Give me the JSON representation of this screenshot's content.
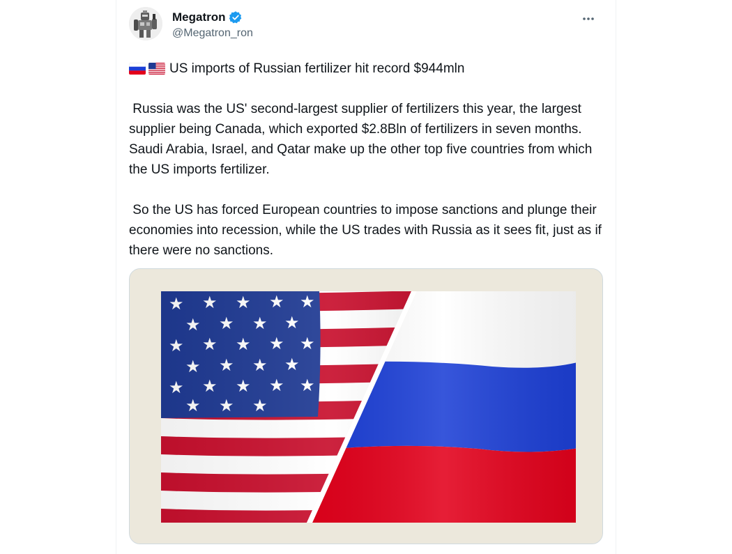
{
  "author": {
    "display_name": "Megatron",
    "handle": "@Megatron_ron",
    "verified": true,
    "avatar_icon": "robot-avatar-icon",
    "verified_icon": "verified-badge-icon"
  },
  "menu": {
    "more_icon": "more-horizontal-icon"
  },
  "tweet": {
    "headline_flags": [
      "russia-flag-icon",
      "usa-flag-icon"
    ],
    "headline": "US imports of Russian fertilizer hit record $944mln",
    "paragraph_1": " Russia was the US' second-largest supplier of fertilizers this year, the largest supplier being Canada, which exported $2.8Bln of fertilizers in seven months.  Saudi Arabia, Israel, and Qatar make up the other top five countries from which the US imports fertilizer.",
    "paragraph_2": " So the US has forced European countries to impose sanctions and plunge their economies into recession, while the US trades with Russia as it sees fit, just as if there were no sanctions."
  },
  "media": {
    "description_icon": "us-and-russia-flags-image"
  },
  "colors": {
    "accent_blue": "#1d9bf0",
    "text_primary": "#0f1419",
    "text_secondary": "#536471",
    "us_red": "#c8102e",
    "us_blue": "#1f3a93",
    "ru_blue": "#1c3fd6",
    "ru_red": "#e3001b"
  }
}
